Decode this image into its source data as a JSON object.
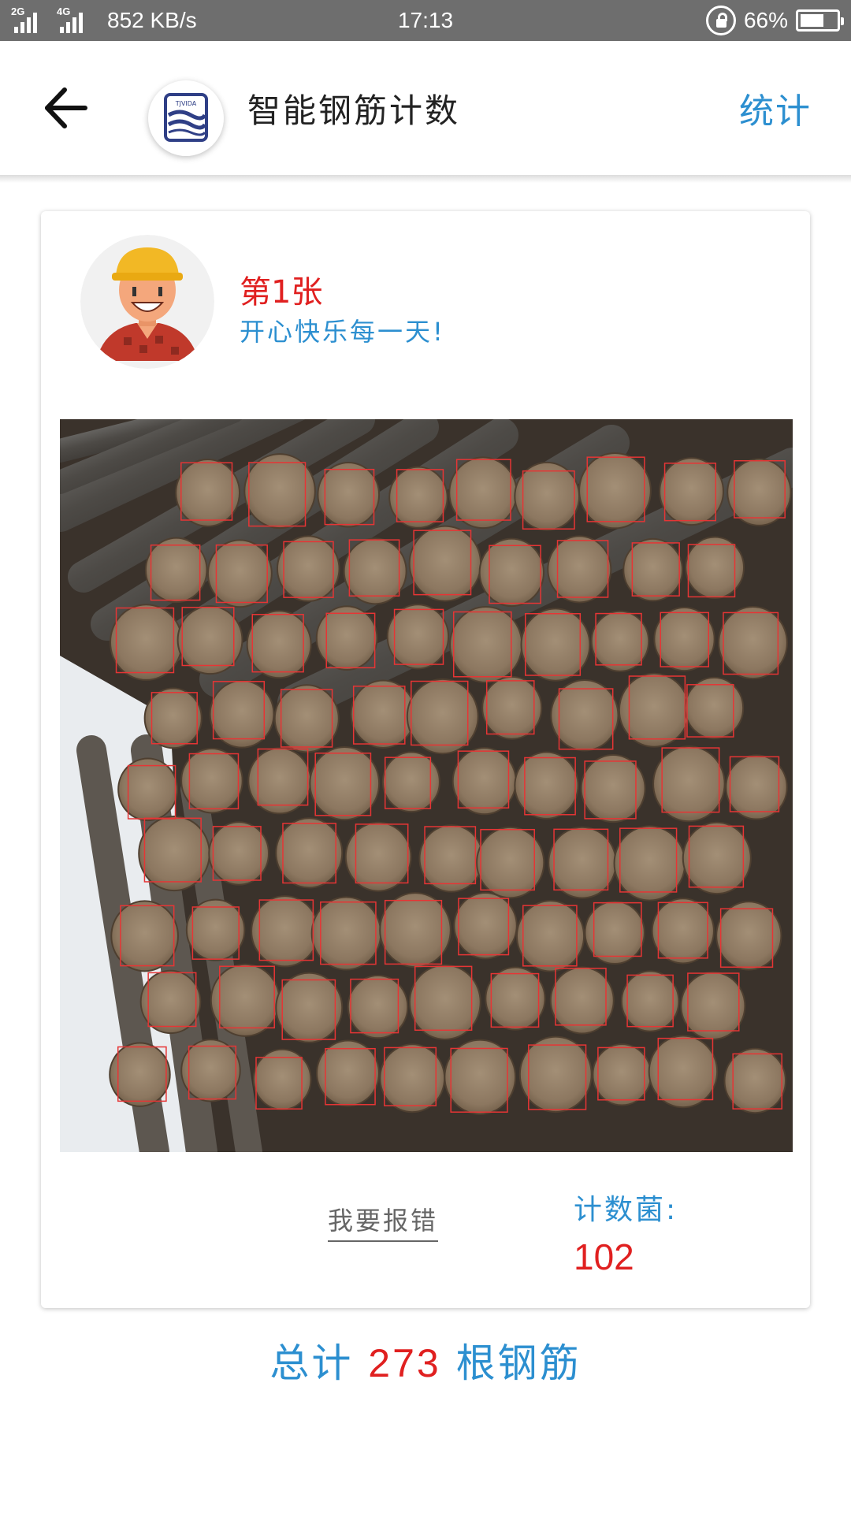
{
  "status_bar": {
    "network_1": "2G",
    "network_2": "4G",
    "speed": "852 KB/s",
    "time": "17:13",
    "battery": "66%",
    "battery_level": 0.66
  },
  "header": {
    "title": "智能钢筋计数",
    "stats_label": "统计",
    "logo_text": "TJVIDA"
  },
  "card": {
    "photo_label": "第1张",
    "motto": "开心快乐每一天!",
    "report_label": "我要报错",
    "count_label": "计数菌:",
    "count_value": "102"
  },
  "footer": {
    "total_prefix": "总计",
    "total_value": "273",
    "total_suffix": "根钢筋"
  },
  "colors": {
    "accent_blue": "#2c8fd0",
    "accent_red": "#e02020",
    "status_bar": "#6e6e6e"
  },
  "icons": [
    "back-arrow-icon",
    "lock-rotation-icon",
    "battery-icon",
    "signal-icon"
  ]
}
